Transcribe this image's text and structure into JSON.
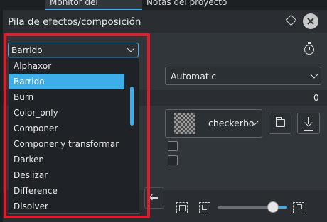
{
  "tabs": [
    {
      "label": "Monitor del proyecto",
      "active": true
    },
    {
      "label": "Notas del proyecto",
      "active": false
    }
  ],
  "panel": {
    "title": "Pila de efectos/composición",
    "float_icon": "float-diamond-icon",
    "close_icon": "close-icon"
  },
  "effect_selector": {
    "selected": "Barrido",
    "options": [
      "Alphaxor",
      "Barrido",
      "Burn",
      "Color_only",
      "Componer",
      "Componer y transformar",
      "Darken",
      "Deslizar",
      "Difference",
      "Disolver"
    ]
  },
  "mode_select": {
    "value": "Automatic"
  },
  "numeric_value": "0",
  "wipe_file": {
    "value": "checkerbo",
    "thumb": "checkerboard-thumbnail"
  },
  "toolbar": {
    "icons": [
      "back-arrow-icon",
      "fit-zoom-icon",
      "zoom-out-icon",
      "zoom-in-icon"
    ],
    "zoom_level": 0.8
  },
  "colors": {
    "accent": "#3daee9",
    "highlight_annotation": "#e11b2a",
    "background": "#31363b"
  }
}
